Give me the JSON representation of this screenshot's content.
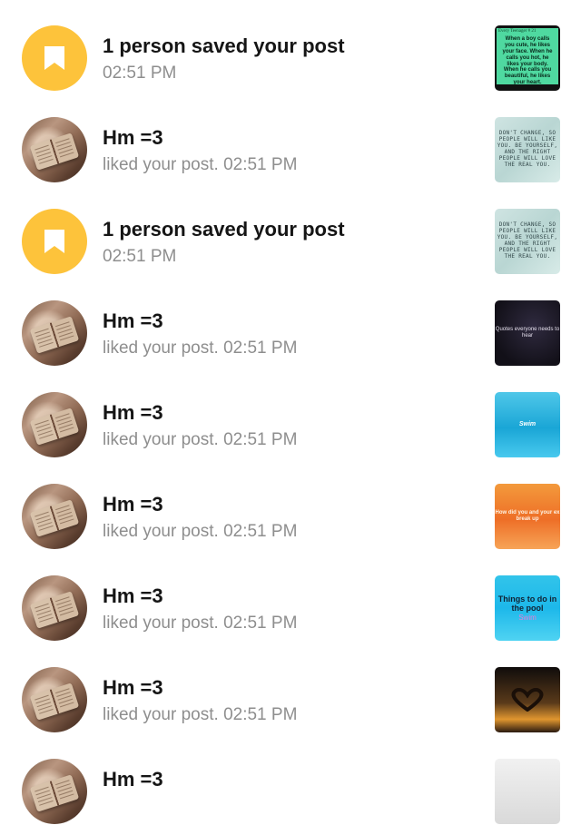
{
  "notifications": [
    {
      "type": "save",
      "title": "1 person saved your post",
      "subtitle": "02:51 PM",
      "thumb": {
        "header": "Every Teenager # 21",
        "text": "When a boy calls you cute, he likes your face. When he calls you hot, he likes your body. When he calls you beautiful, he likes your heart."
      }
    },
    {
      "type": "like",
      "title": "Hm =3",
      "subtitle": "liked your post. 02:51 PM",
      "thumb": {
        "text": "DON'T CHANGE, SO PEOPLE WILL LIKE YOU. BE YOURSELF, AND THE RIGHT PEOPLE WILL LOVE THE REAL YOU."
      }
    },
    {
      "type": "save",
      "title": "1 person saved your post",
      "subtitle": "02:51 PM",
      "thumb": {
        "text": "DON'T CHANGE, SO PEOPLE WILL LIKE YOU. BE YOURSELF, AND THE RIGHT PEOPLE WILL LOVE THE REAL YOU."
      }
    },
    {
      "type": "like",
      "title": "Hm =3",
      "subtitle": "liked your post. 02:51 PM",
      "thumb": {
        "text": "Quotes everyone needs to hear"
      }
    },
    {
      "type": "like",
      "title": "Hm =3",
      "subtitle": "liked your post. 02:51 PM",
      "thumb": {
        "text": "Swim"
      }
    },
    {
      "type": "like",
      "title": "Hm =3",
      "subtitle": "liked your post. 02:51 PM",
      "thumb": {
        "text": "How did you and your ex break up"
      }
    },
    {
      "type": "like",
      "title": "Hm =3",
      "subtitle": "liked your post. 02:51 PM",
      "thumb": {
        "text": "Things to do in the pool",
        "text2": "Swim"
      }
    },
    {
      "type": "like",
      "title": "Hm =3",
      "subtitle": "liked your post. 02:51 PM",
      "thumb": {
        "text": ""
      }
    },
    {
      "type": "like",
      "title": "Hm =3",
      "subtitle": "",
      "thumb": {
        "text": ""
      }
    }
  ],
  "colors": {
    "save_badge": "#fdc33b",
    "title": "#151515",
    "subtitle": "#8e8e8e"
  },
  "icons": {
    "save": "bookmark-icon"
  }
}
